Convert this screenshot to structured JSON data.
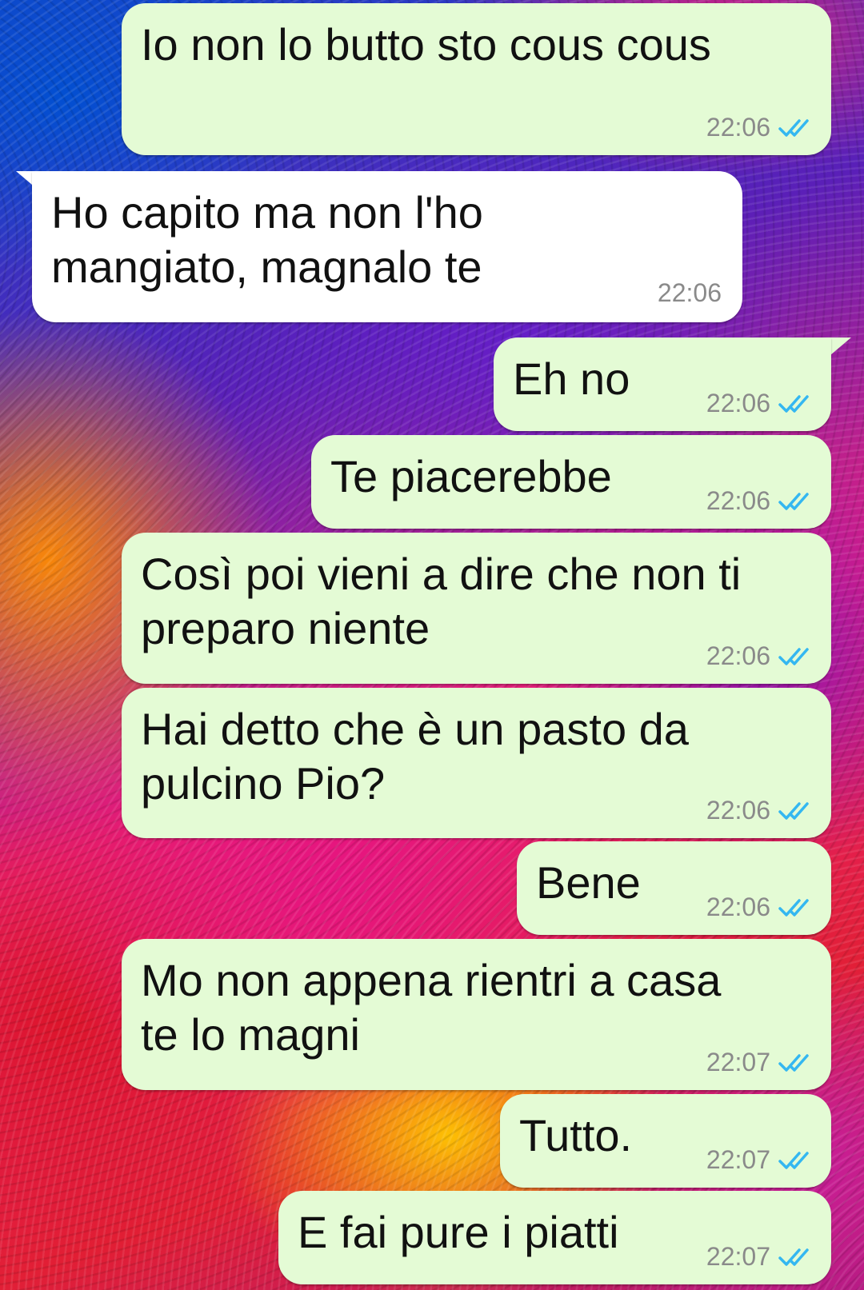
{
  "messages": [
    {
      "text": "Io non lo butto sto cous cous",
      "time": "22:06",
      "direction": "outgoing",
      "status": "read"
    },
    {
      "text": "Ho capito ma non l'ho\nmangiato, magnalo te",
      "time": "22:06",
      "direction": "incoming"
    },
    {
      "text": "Eh no",
      "time": "22:06",
      "direction": "outgoing",
      "status": "read"
    },
    {
      "text": "Te piacerebbe",
      "time": "22:06",
      "direction": "outgoing",
      "status": "read"
    },
    {
      "text": "Così poi vieni a dire che non ti\npreparo niente",
      "time": "22:06",
      "direction": "outgoing",
      "status": "read"
    },
    {
      "text": "Hai detto che è un pasto da\npulcino Pio?",
      "time": "22:06",
      "direction": "outgoing",
      "status": "read"
    },
    {
      "text": "Bene",
      "time": "22:06",
      "direction": "outgoing",
      "status": "read"
    },
    {
      "text": "Mo non appena rientri a casa\nte lo magni",
      "time": "22:07",
      "direction": "outgoing",
      "status": "read"
    },
    {
      "text": "Tutto.",
      "time": "22:07",
      "direction": "outgoing",
      "status": "read"
    },
    {
      "text": "E fai pure i piatti",
      "time": "22:07",
      "direction": "outgoing",
      "status": "read"
    }
  ],
  "icons": {
    "read_receipt": "double-check-icon"
  },
  "colors": {
    "outgoing_bubble": "#e4fbd5",
    "incoming_bubble": "#ffffff",
    "read_tick": "#34b7f1",
    "timestamp": "#8a8a8a"
  }
}
